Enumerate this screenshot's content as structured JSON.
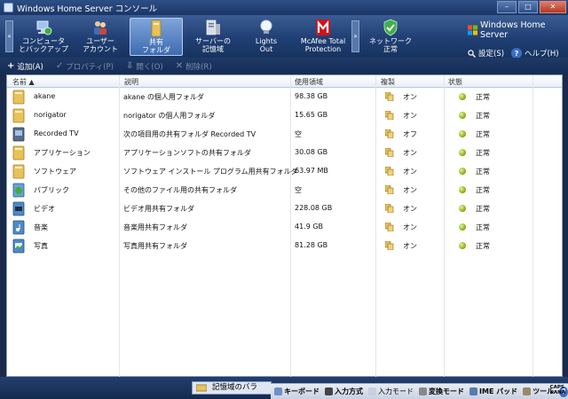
{
  "window": {
    "title": "Windows Home Server コンソール"
  },
  "nav": {
    "tabs": [
      {
        "label": "コンピュータ\nとバックアップ",
        "icon": "computer-backup-icon"
      },
      {
        "label": "ユーザー\nアカウント",
        "icon": "user-accounts-icon"
      },
      {
        "label": "共有\nフォルダ",
        "icon": "shared-folder-icon",
        "active": true
      },
      {
        "label": "サーバーの\n記憶域",
        "icon": "server-storage-icon"
      },
      {
        "label": "Lights\nOut",
        "icon": "lightbulb-icon"
      },
      {
        "label": "McAfee Total\nProtection",
        "icon": "mcafee-icon"
      },
      {
        "label": "ネットワーク\n正常",
        "icon": "network-shield-icon"
      }
    ],
    "brand": "Windows Home Server",
    "settings_label": "設定(S)",
    "help_label": "ヘルプ(H)"
  },
  "toolbar": {
    "add": "追加(A)",
    "properties": "プロパティ(P)",
    "open": "開く(O)",
    "delete": "削除(R)"
  },
  "table": {
    "columns": [
      "名前",
      "説明",
      "使用領域",
      "複製",
      "状態"
    ],
    "rows": [
      {
        "name": "akane",
        "description": "akane の個人用フォルダ",
        "used": "98.38 GB",
        "duplication": "オン",
        "status": "正常",
        "icon": "folder-icon"
      },
      {
        "name": "norigator",
        "description": "norigator の個人用フォルダ",
        "used": "15.65 GB",
        "duplication": "オン",
        "status": "正常",
        "icon": "folder-icon"
      },
      {
        "name": "Recorded TV",
        "description": "次の項目用の共有フォルダ Recorded TV",
        "used": "空",
        "duplication": "オフ",
        "status": "正常",
        "icon": "tv-folder-icon"
      },
      {
        "name": "アプリケーション",
        "description": "アプリケーションソフトの共有フォルダ",
        "used": "30.08 GB",
        "duplication": "オン",
        "status": "正常",
        "icon": "folder-icon"
      },
      {
        "name": "ソフトウェア",
        "description": "ソフトウェア インストール プログラム用共有フォルダ",
        "used": "63.97 MB",
        "duplication": "オン",
        "status": "正常",
        "icon": "folder-icon"
      },
      {
        "name": "パブリック",
        "description": "その他のファイル用の共有フォルダ",
        "used": "空",
        "duplication": "オン",
        "status": "正常",
        "icon": "globe-folder-icon"
      },
      {
        "name": "ビデオ",
        "description": "ビデオ用共有フォルダ",
        "used": "228.08 GB",
        "duplication": "オン",
        "status": "正常",
        "icon": "video-folder-icon"
      },
      {
        "name": "音楽",
        "description": "音楽用共有フォルダ",
        "used": "41.9 GB",
        "duplication": "オン",
        "status": "正常",
        "icon": "music-folder-icon"
      },
      {
        "name": "写真",
        "description": "写真用共有フォルダ",
        "used": "81.28 GB",
        "duplication": "オン",
        "status": "正常",
        "icon": "photo-folder-icon"
      }
    ]
  },
  "statusbar": {
    "message": "記憶域のバラ"
  },
  "langbar": {
    "items": [
      "キーボード",
      "入力方式",
      "入力モード",
      "変換モード",
      "IME パッド",
      "ツール"
    ],
    "caps": "CAPS",
    "kana": "KANA"
  },
  "colors": {
    "status_ok": "#8cb515",
    "nav_bg": "#203f74",
    "active_tab": "#5f8ccb"
  }
}
